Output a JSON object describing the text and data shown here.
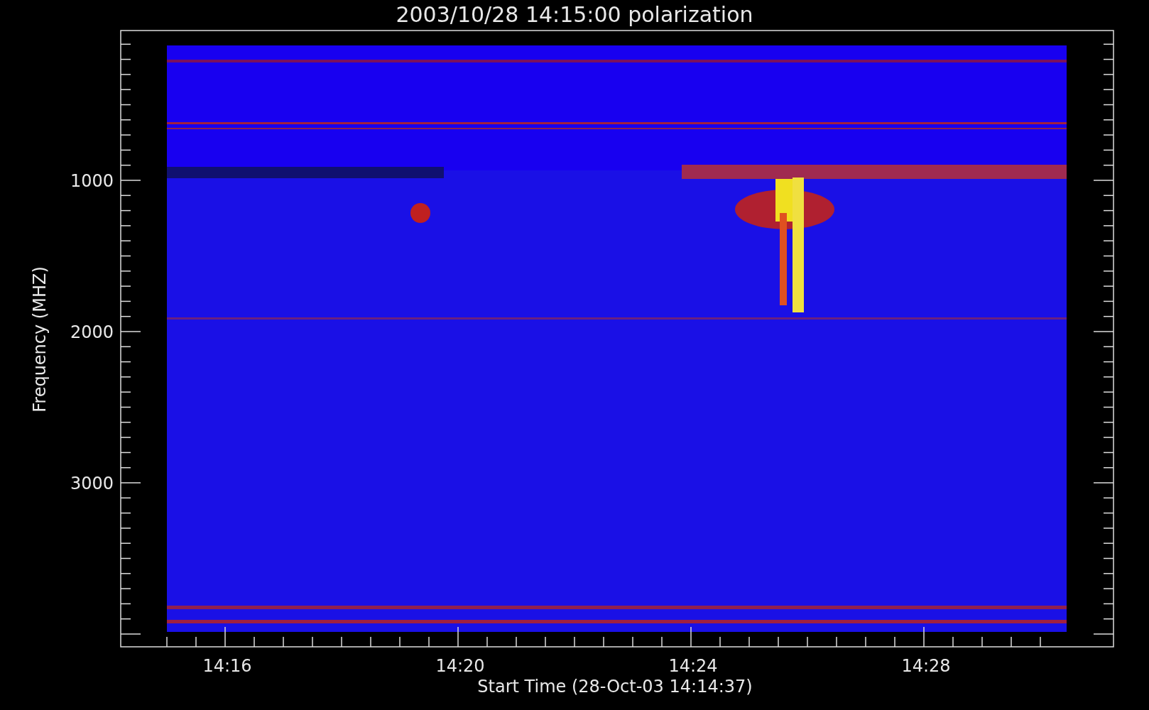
{
  "title": "2003/10/28 14:15:00 polarization",
  "y_axis": {
    "label": "Frequency (MHZ)",
    "ticks": [
      "1000",
      "2000",
      "3000"
    ]
  },
  "x_axis": {
    "label": "Start Time (28-Oct-03 14:14:37)",
    "ticks": [
      "14:16",
      "14:20",
      "14:24",
      "14:28"
    ]
  }
}
